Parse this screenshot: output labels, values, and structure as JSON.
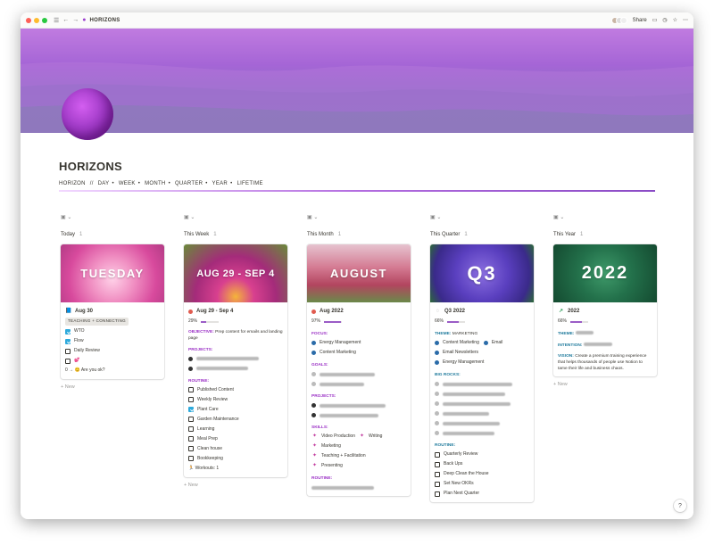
{
  "window": {
    "tab_title": "HORIZONS",
    "share_label": "Share"
  },
  "page": {
    "title": "HORIZONS"
  },
  "nav": {
    "label": "HORIZON",
    "divider": "//",
    "items": [
      "DAY",
      "WEEK",
      "MONTH",
      "QUARTER",
      "YEAR",
      "LIFETIME"
    ]
  },
  "colors": {
    "accent": "#9a2fc5",
    "link": "#2a6ba8",
    "checkbox": "#2eaadc"
  },
  "columns": [
    {
      "heading": "Today",
      "count": "1",
      "cover_text": "TUESDAY",
      "title_emoji": "📘",
      "title": "Aug 30",
      "tag": "TEACHING + CONNECTING",
      "checklist": [
        {
          "label": "WTO",
          "checked": true
        },
        {
          "label": "Flow",
          "checked": true
        },
        {
          "label": "Daily Review",
          "checked": false
        },
        {
          "label": "💕",
          "checked": false
        }
      ],
      "footer": "0 → 😊 Are you ok?",
      "add_label": "+ New"
    },
    {
      "heading": "This Week",
      "count": "1",
      "cover_text": "AUG 29 - SEP 4",
      "title": "Aug 29 - Sep 4",
      "progress_label": "29%",
      "progress_value": 0.29,
      "objective_label": "OBJECTIVE:",
      "objective_text": "Prep content for emails and landing page",
      "projects_label": "PROJECTS:",
      "routine_label": "ROUTINE:",
      "routine": [
        {
          "label": "Published Content",
          "checked": false
        },
        {
          "label": "Weekly Review",
          "checked": false
        },
        {
          "label": "Plant Care",
          "checked": true
        },
        {
          "label": "Garden Maintenance",
          "checked": false
        },
        {
          "label": "Learning",
          "checked": false
        },
        {
          "label": "Meal Prep",
          "checked": false
        },
        {
          "label": "Clean house",
          "checked": false
        },
        {
          "label": "Bookkeeping",
          "checked": false
        }
      ],
      "footer": "🏃 Workouts: 1",
      "add_label": "+ New"
    },
    {
      "heading": "This Month",
      "count": "1",
      "cover_text": "AUGUST",
      "title": "Aug 2022",
      "progress_label": "97%",
      "progress_value": 0.97,
      "focus_label": "FOCUS:",
      "focus": [
        "Energy Management",
        "Content Marketing"
      ],
      "goals_label": "GOALS:",
      "projects_label": "PROJECTS:",
      "skills_label": "SKILLS:",
      "skills": [
        "Video Production",
        "Writing",
        "Marketing",
        "Teaching + Facilitation",
        "Presenting"
      ],
      "routine_label": "ROUTINE:"
    },
    {
      "heading": "This Quarter",
      "count": "1",
      "cover_text": "Q3",
      "title": "Q3 2022",
      "progress_label": "66%",
      "progress_value": 0.66,
      "theme_label": "THEME:",
      "theme_value": "MARKETING",
      "theme_items": [
        "Content Marketing",
        "Email",
        "Email Newsletters",
        "Energy Management"
      ],
      "big_rocks_label": "BIG ROCKS:",
      "routine_label": "ROUTINE:",
      "routine": [
        "Quarterly Review",
        "Back Ups",
        "Deep Clean the House",
        "Set New OKRs",
        "Plan Next Quarter"
      ]
    },
    {
      "heading": "This Year",
      "count": "1",
      "cover_text": "2022",
      "title": "2022",
      "progress_label": "66%",
      "progress_value": 0.66,
      "theme_label": "THEME:",
      "intention_label": "INTENTION:",
      "vision_label": "VISION:",
      "vision_text": "Create a premium training experience that helps thousands of people use Notion to tame their life and business chaos.",
      "add_label": "+ New"
    }
  ]
}
